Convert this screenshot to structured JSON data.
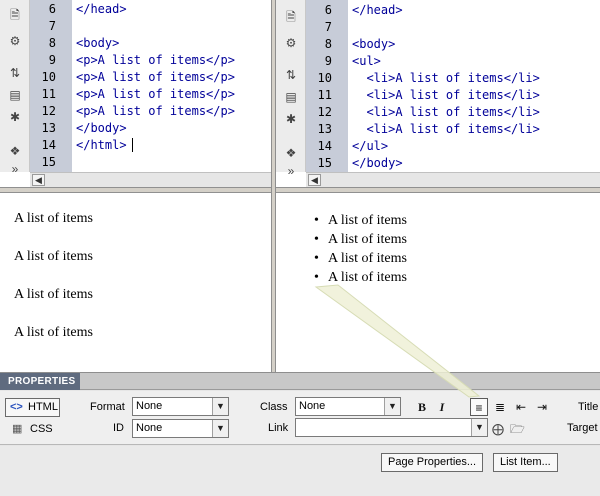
{
  "left_pane": {
    "code_lines": [
      {
        "num": "6",
        "text": "</head>"
      },
      {
        "num": "7",
        "text": ""
      },
      {
        "num": "8",
        "text": "<body>"
      },
      {
        "num": "9",
        "text": "<p>A list of items</p>"
      },
      {
        "num": "10",
        "text": "<p>A list of items</p>"
      },
      {
        "num": "11",
        "text": "<p>A list of items</p>"
      },
      {
        "num": "12",
        "text": "<p>A list of items</p>"
      },
      {
        "num": "13",
        "text": "</body>"
      },
      {
        "num": "14",
        "text": "</html>"
      },
      {
        "num": "15",
        "text": ""
      }
    ],
    "design_paragraphs": [
      "A list of items",
      "A list of items",
      "A list of items",
      "A list of items"
    ]
  },
  "right_pane": {
    "code_lines": [
      {
        "num": "6",
        "text": "</head>"
      },
      {
        "num": "7",
        "text": ""
      },
      {
        "num": "8",
        "text": "<body>"
      },
      {
        "num": "9",
        "text": "<ul>"
      },
      {
        "num": "10",
        "text": "  <li>A list of items</li>"
      },
      {
        "num": "11",
        "text": "  <li>A list of items</li>"
      },
      {
        "num": "12",
        "text": "  <li>A list of items</li>"
      },
      {
        "num": "13",
        "text": "  <li>A list of items</li>"
      },
      {
        "num": "14",
        "text": "</ul>"
      },
      {
        "num": "15",
        "text": "</body>"
      }
    ],
    "design_list_items": [
      "A list of items",
      "A list of items",
      "A list of items",
      "A list of items"
    ]
  },
  "toolbar_icons": [
    "document-icon",
    "gear-icon",
    "expand-icon",
    "select-tag-icon",
    "asterisk-icon",
    "collapse-icon",
    "more-icon"
  ],
  "properties": {
    "title": "PROPERTIES",
    "html_button": "HTML",
    "css_button": "CSS",
    "format_label": "Format",
    "format_value": "None",
    "id_label": "ID",
    "id_value": "None",
    "class_label": "Class",
    "class_value": "None",
    "link_label": "Link",
    "link_value": "",
    "bold": "B",
    "italic": "I",
    "title_label": "Title",
    "target_label": "Target",
    "page_properties_button": "Page Properties...",
    "list_item_button": "List Item..."
  },
  "colors": {
    "code_text": "#000099",
    "gutter": "#c7ccd8",
    "panel_header": "#5f6b7f",
    "callout": "#e8ecd2"
  }
}
